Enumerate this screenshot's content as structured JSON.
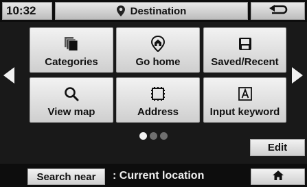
{
  "header": {
    "time": "10:32",
    "title": "Destination",
    "title_icon": "map-pin-icon",
    "back_icon": "back-arrow-icon"
  },
  "menu": {
    "tiles": [
      {
        "label": "Categories",
        "icon": "categories-icon"
      },
      {
        "label": "Go home",
        "icon": "home-pin-icon"
      },
      {
        "label": "Saved/Recent",
        "icon": "save-icon"
      },
      {
        "label": "View map",
        "icon": "magnifier-icon"
      },
      {
        "label": "Address",
        "icon": "address-icon"
      },
      {
        "label": "Input keyword",
        "icon": "keyword-icon"
      }
    ],
    "page_count": 3,
    "current_page": 1,
    "prev_icon": "arrow-left-icon",
    "next_icon": "arrow-right-icon"
  },
  "actions": {
    "edit_label": "Edit"
  },
  "footer": {
    "search_near_label": "Search near",
    "location_text": ": Current location",
    "home_icon": "home-icon"
  },
  "colors": {
    "background": "#191919",
    "button_light": "#f2f2f2",
    "button_dark": "#cfcfcf",
    "text": "#111111",
    "footer_text": "#f2f2f2"
  }
}
